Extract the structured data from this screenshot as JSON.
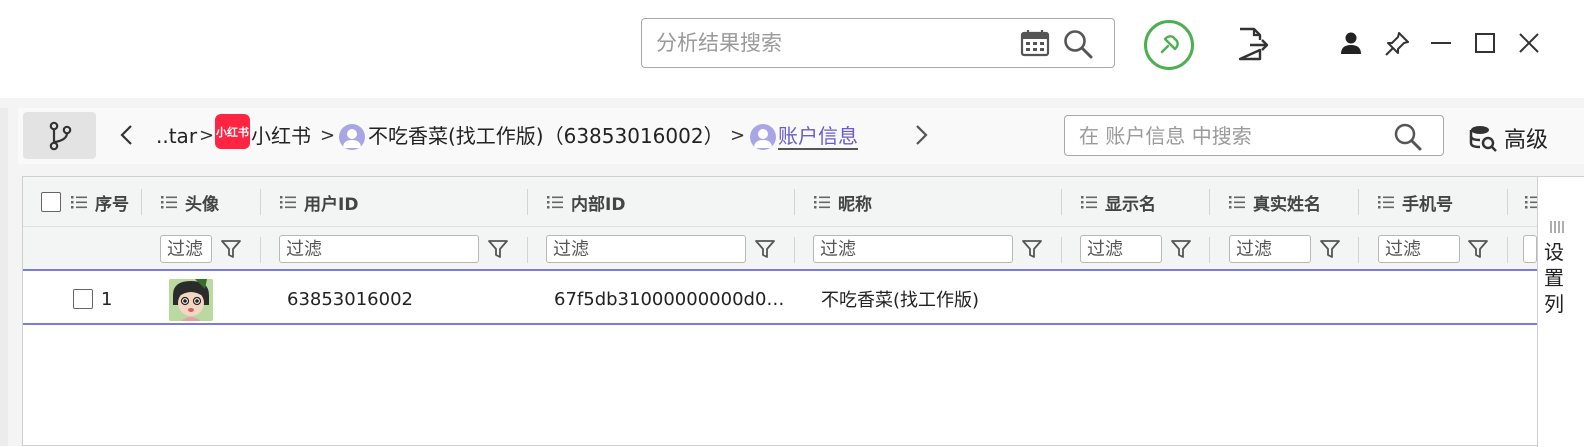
{
  "topbar": {
    "result_search_placeholder": "分析结果搜索",
    "icons": [
      "calendar-icon",
      "search-icon",
      "map-pin-icon",
      "export-icon",
      "user-icon",
      "pushpin-icon",
      "minimize-icon",
      "maximize-icon",
      "close-icon"
    ]
  },
  "breadcrumb": {
    "items": [
      {
        "label": "..tar"
      },
      {
        "label": "小红书",
        "logo_text": "小红书"
      },
      {
        "label": "不吃香菜(找工作版)（63853016002）"
      },
      {
        "label": "账户信息",
        "active": true
      }
    ],
    "separator": ">"
  },
  "scope_search": {
    "placeholder": "在 账户信息 中搜索"
  },
  "advanced_label": "高级",
  "table": {
    "columns": [
      "序号",
      "头像",
      "用户ID",
      "内部ID",
      "昵称",
      "显示名",
      "真实姓名",
      "手机号"
    ],
    "filter_placeholder": "过滤",
    "rows": [
      {
        "index": "1",
        "avatar": "avatar-image",
        "user_id": "63853016002",
        "internal_id": "67f5db31000000000d0…",
        "nickname": "不吃香菜(找工作版)",
        "display_name": "",
        "real_name": "",
        "phone": ""
      }
    ]
  },
  "settings_column_label": "设置列",
  "colors": {
    "accent_green": "#4caf50",
    "row_border": "#7b7bdc",
    "xhs_red": "#ff2442",
    "active_crumb": "#6a5acd"
  }
}
